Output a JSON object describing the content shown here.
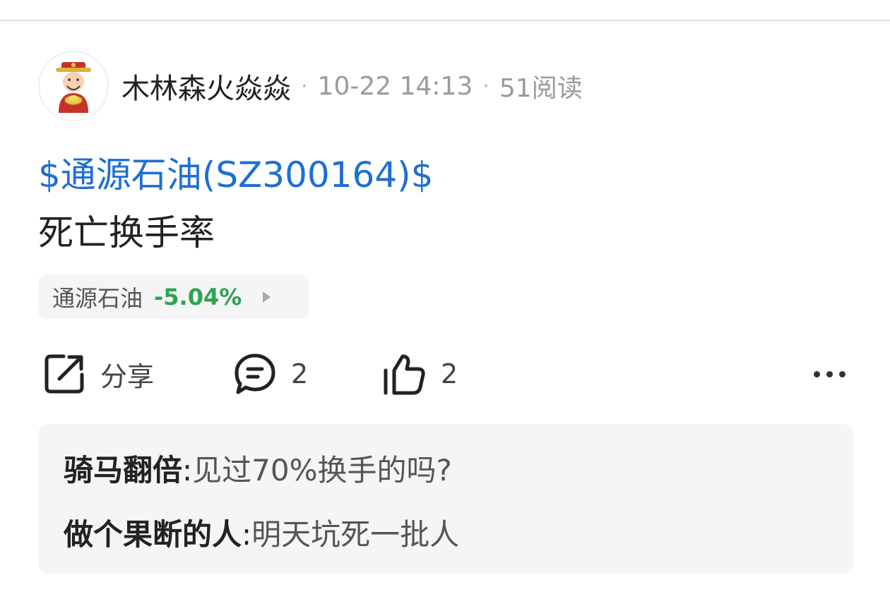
{
  "post": {
    "author": "木林森火焱焱",
    "time": "10-22 14:13",
    "reads": "51阅读",
    "separator": "·",
    "stock_link": "$通源石油(SZ300164)$",
    "text": "死亡换手率"
  },
  "stock_chip": {
    "name": "通源石油",
    "change": "-5.04%",
    "change_color": "#2ea44f"
  },
  "actions": {
    "share_label": "分享",
    "comment_count": "2",
    "like_count": "2"
  },
  "comments": [
    {
      "user": "骑马翻倍",
      "colon": ":",
      "text": "见过70%换手的吗?"
    },
    {
      "user": "做个果断的人",
      "colon": ":",
      "text": "明天坑死一批人"
    }
  ],
  "icons": {
    "avatar": "caishen-avatar",
    "share": "share-icon",
    "comment": "comment-icon",
    "like": "thumbs-up-icon",
    "more": "more-icon"
  },
  "colors": {
    "link": "#1f6fd1",
    "down": "#2ea44f",
    "panel_bg": "#f5f5f7"
  }
}
